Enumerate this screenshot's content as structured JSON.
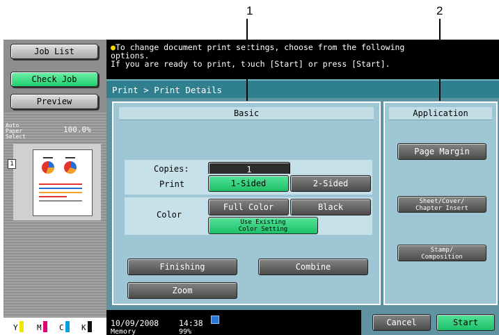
{
  "callouts": {
    "one": "1",
    "two": "2"
  },
  "left_panel": {
    "job_list": "Job List",
    "check_job": "Check Job",
    "preview": "Preview",
    "paper_select": "Auto Paper\nSelect",
    "zoom": "100.0%",
    "page_icon": "1"
  },
  "message": {
    "line1": "To change document print settings, choose from the following",
    "line2": "options.",
    "line3": "If you are ready to print, touch [Start] or press [Start].",
    "icon": "lightbulb-icon"
  },
  "breadcrumb": "Print > Print Details",
  "basic": {
    "title": "Basic",
    "copies_label": "Copies:",
    "copies_value": "1",
    "print_label": "Print",
    "one_sided": "1-Sided",
    "two_sided": "2-Sided",
    "color_label": "Color",
    "full_color": "Full Color",
    "black": "Black",
    "use_existing_l1": "Use Existing",
    "use_existing_l2": "Color Setting",
    "finishing": "Finishing",
    "combine": "Combine",
    "zoom": "Zoom"
  },
  "application": {
    "title": "Application",
    "page_margin": "Page Margin",
    "sheet_l1": "Sheet/Cover/",
    "sheet_l2": "Chapter Insert",
    "stamp_l1": "Stamp/",
    "stamp_l2": "Composition"
  },
  "bottom": {
    "date": "10/09/2008",
    "time": "14:38",
    "memory_label": "Memory",
    "memory_value": "99%",
    "cancel": "Cancel",
    "start": "Start",
    "toner_labels": [
      "Y",
      "M",
      "C",
      "K"
    ],
    "toner_colors": [
      "#f2e600",
      "#e0007a",
      "#00a0e0",
      "#111111"
    ]
  }
}
